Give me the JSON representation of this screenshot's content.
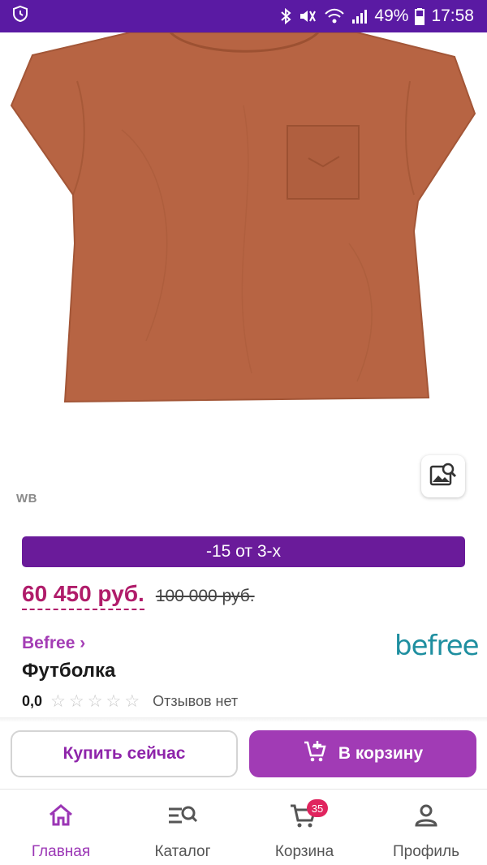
{
  "status_bar": {
    "battery": "49%",
    "time": "17:58",
    "icons": [
      "shield-clock-icon",
      "bluetooth-icon",
      "mute-icon",
      "wifi-icon",
      "signal-icon",
      "battery-icon"
    ]
  },
  "product": {
    "image_icon": "t-shirt-image",
    "wb_mark": "WB",
    "promo": "-15 от 3-х",
    "price_current": "60 450 руб.",
    "price_old": "100 000 руб.",
    "brand": "Befree ›",
    "brand_logo": "befree",
    "title": "Футболка",
    "rating": "0,0",
    "rating_stars": 0,
    "stars_total": 5,
    "reviews": "Отзывов нет"
  },
  "actions": {
    "buy_now": "Купить сейчас",
    "add_to_cart": "В корзину"
  },
  "bottom_nav": {
    "items": [
      {
        "label": "Главная",
        "icon": "home-icon",
        "active": true
      },
      {
        "label": "Каталог",
        "icon": "catalog-search-icon",
        "active": false
      },
      {
        "label": "Корзина",
        "icon": "cart-icon",
        "active": false,
        "badge": "35"
      },
      {
        "label": "Профиль",
        "icon": "profile-icon",
        "active": false
      }
    ]
  },
  "colors": {
    "status_bar": "#5a1aa3",
    "promo": "#6a1b9a",
    "price": "#b01c6a",
    "accent": "#a13bb5",
    "brand_logo": "#1f8fa0",
    "badge": "#e0245e"
  }
}
